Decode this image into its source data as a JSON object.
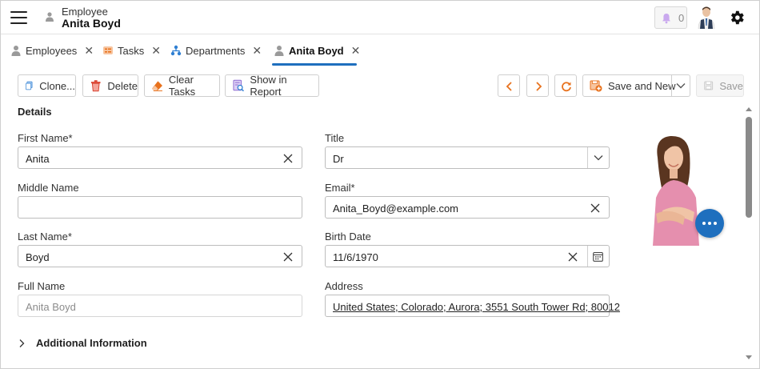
{
  "header": {
    "subtitle": "Employee",
    "title": "Anita Boyd",
    "notification_count": "0"
  },
  "tabs": [
    {
      "label": "Employees",
      "icon": "person-icon"
    },
    {
      "label": "Tasks",
      "icon": "tasks-icon"
    },
    {
      "label": "Departments",
      "icon": "departments-icon"
    },
    {
      "label": "Anita Boyd",
      "icon": "person-icon",
      "active": true
    }
  ],
  "toolbar": {
    "clone": "Clone...",
    "delete": "Delete",
    "clear_tasks": "Clear Tasks",
    "show_in_report": "Show in Report",
    "save_and_new": "Save and New",
    "save": "Save"
  },
  "form": {
    "section_title": "Details",
    "first_name": {
      "label": "First Name*",
      "value": "Anita"
    },
    "middle_name": {
      "label": "Middle Name",
      "value": ""
    },
    "last_name": {
      "label": "Last Name*",
      "value": "Boyd"
    },
    "full_name": {
      "label": "Full Name",
      "value": "Anita Boyd"
    },
    "title": {
      "label": "Title",
      "value": "Dr"
    },
    "email": {
      "label": "Email*",
      "value": "Anita_Boyd@example.com"
    },
    "birth_date": {
      "label": "Birth Date",
      "value": "11/6/1970"
    },
    "address": {
      "label": "Address",
      "value": "United States; Colorado; Aurora; 3551 South Tower Rd; 80012"
    },
    "additional_information": "Additional Information"
  },
  "colors": {
    "accent": "#1e6fbe",
    "icon_orange": "#e8711c",
    "icon_blue": "#2f7fd2",
    "icon_red": "#d9412f",
    "notification_bell": "#b78be6"
  }
}
